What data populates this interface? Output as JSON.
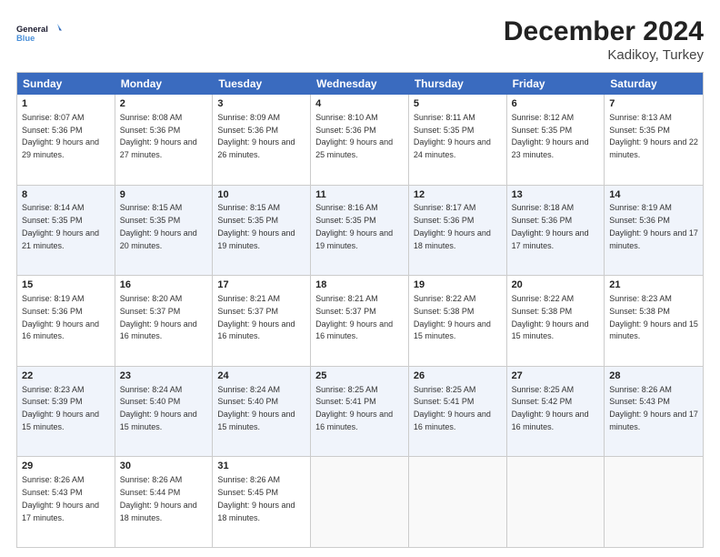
{
  "logo": {
    "line1": "General",
    "line2": "Blue"
  },
  "title": "December 2024",
  "subtitle": "Kadikoy, Turkey",
  "weekdays": [
    "Sunday",
    "Monday",
    "Tuesday",
    "Wednesday",
    "Thursday",
    "Friday",
    "Saturday"
  ],
  "rows": [
    [
      {
        "day": "1",
        "sunrise": "Sunrise: 8:07 AM",
        "sunset": "Sunset: 5:36 PM",
        "daylight": "Daylight: 9 hours and 29 minutes."
      },
      {
        "day": "2",
        "sunrise": "Sunrise: 8:08 AM",
        "sunset": "Sunset: 5:36 PM",
        "daylight": "Daylight: 9 hours and 27 minutes."
      },
      {
        "day": "3",
        "sunrise": "Sunrise: 8:09 AM",
        "sunset": "Sunset: 5:36 PM",
        "daylight": "Daylight: 9 hours and 26 minutes."
      },
      {
        "day": "4",
        "sunrise": "Sunrise: 8:10 AM",
        "sunset": "Sunset: 5:36 PM",
        "daylight": "Daylight: 9 hours and 25 minutes."
      },
      {
        "day": "5",
        "sunrise": "Sunrise: 8:11 AM",
        "sunset": "Sunset: 5:35 PM",
        "daylight": "Daylight: 9 hours and 24 minutes."
      },
      {
        "day": "6",
        "sunrise": "Sunrise: 8:12 AM",
        "sunset": "Sunset: 5:35 PM",
        "daylight": "Daylight: 9 hours and 23 minutes."
      },
      {
        "day": "7",
        "sunrise": "Sunrise: 8:13 AM",
        "sunset": "Sunset: 5:35 PM",
        "daylight": "Daylight: 9 hours and 22 minutes."
      }
    ],
    [
      {
        "day": "8",
        "sunrise": "Sunrise: 8:14 AM",
        "sunset": "Sunset: 5:35 PM",
        "daylight": "Daylight: 9 hours and 21 minutes."
      },
      {
        "day": "9",
        "sunrise": "Sunrise: 8:15 AM",
        "sunset": "Sunset: 5:35 PM",
        "daylight": "Daylight: 9 hours and 20 minutes."
      },
      {
        "day": "10",
        "sunrise": "Sunrise: 8:15 AM",
        "sunset": "Sunset: 5:35 PM",
        "daylight": "Daylight: 9 hours and 19 minutes."
      },
      {
        "day": "11",
        "sunrise": "Sunrise: 8:16 AM",
        "sunset": "Sunset: 5:35 PM",
        "daylight": "Daylight: 9 hours and 19 minutes."
      },
      {
        "day": "12",
        "sunrise": "Sunrise: 8:17 AM",
        "sunset": "Sunset: 5:36 PM",
        "daylight": "Daylight: 9 hours and 18 minutes."
      },
      {
        "day": "13",
        "sunrise": "Sunrise: 8:18 AM",
        "sunset": "Sunset: 5:36 PM",
        "daylight": "Daylight: 9 hours and 17 minutes."
      },
      {
        "day": "14",
        "sunrise": "Sunrise: 8:19 AM",
        "sunset": "Sunset: 5:36 PM",
        "daylight": "Daylight: 9 hours and 17 minutes."
      }
    ],
    [
      {
        "day": "15",
        "sunrise": "Sunrise: 8:19 AM",
        "sunset": "Sunset: 5:36 PM",
        "daylight": "Daylight: 9 hours and 16 minutes."
      },
      {
        "day": "16",
        "sunrise": "Sunrise: 8:20 AM",
        "sunset": "Sunset: 5:37 PM",
        "daylight": "Daylight: 9 hours and 16 minutes."
      },
      {
        "day": "17",
        "sunrise": "Sunrise: 8:21 AM",
        "sunset": "Sunset: 5:37 PM",
        "daylight": "Daylight: 9 hours and 16 minutes."
      },
      {
        "day": "18",
        "sunrise": "Sunrise: 8:21 AM",
        "sunset": "Sunset: 5:37 PM",
        "daylight": "Daylight: 9 hours and 16 minutes."
      },
      {
        "day": "19",
        "sunrise": "Sunrise: 8:22 AM",
        "sunset": "Sunset: 5:38 PM",
        "daylight": "Daylight: 9 hours and 15 minutes."
      },
      {
        "day": "20",
        "sunrise": "Sunrise: 8:22 AM",
        "sunset": "Sunset: 5:38 PM",
        "daylight": "Daylight: 9 hours and 15 minutes."
      },
      {
        "day": "21",
        "sunrise": "Sunrise: 8:23 AM",
        "sunset": "Sunset: 5:38 PM",
        "daylight": "Daylight: 9 hours and 15 minutes."
      }
    ],
    [
      {
        "day": "22",
        "sunrise": "Sunrise: 8:23 AM",
        "sunset": "Sunset: 5:39 PM",
        "daylight": "Daylight: 9 hours and 15 minutes."
      },
      {
        "day": "23",
        "sunrise": "Sunrise: 8:24 AM",
        "sunset": "Sunset: 5:40 PM",
        "daylight": "Daylight: 9 hours and 15 minutes."
      },
      {
        "day": "24",
        "sunrise": "Sunrise: 8:24 AM",
        "sunset": "Sunset: 5:40 PM",
        "daylight": "Daylight: 9 hours and 15 minutes."
      },
      {
        "day": "25",
        "sunrise": "Sunrise: 8:25 AM",
        "sunset": "Sunset: 5:41 PM",
        "daylight": "Daylight: 9 hours and 16 minutes."
      },
      {
        "day": "26",
        "sunrise": "Sunrise: 8:25 AM",
        "sunset": "Sunset: 5:41 PM",
        "daylight": "Daylight: 9 hours and 16 minutes."
      },
      {
        "day": "27",
        "sunrise": "Sunrise: 8:25 AM",
        "sunset": "Sunset: 5:42 PM",
        "daylight": "Daylight: 9 hours and 16 minutes."
      },
      {
        "day": "28",
        "sunrise": "Sunrise: 8:26 AM",
        "sunset": "Sunset: 5:43 PM",
        "daylight": "Daylight: 9 hours and 17 minutes."
      }
    ],
    [
      {
        "day": "29",
        "sunrise": "Sunrise: 8:26 AM",
        "sunset": "Sunset: 5:43 PM",
        "daylight": "Daylight: 9 hours and 17 minutes."
      },
      {
        "day": "30",
        "sunrise": "Sunrise: 8:26 AM",
        "sunset": "Sunset: 5:44 PM",
        "daylight": "Daylight: 9 hours and 18 minutes."
      },
      {
        "day": "31",
        "sunrise": "Sunrise: 8:26 AM",
        "sunset": "Sunset: 5:45 PM",
        "daylight": "Daylight: 9 hours and 18 minutes."
      },
      null,
      null,
      null,
      null
    ]
  ]
}
